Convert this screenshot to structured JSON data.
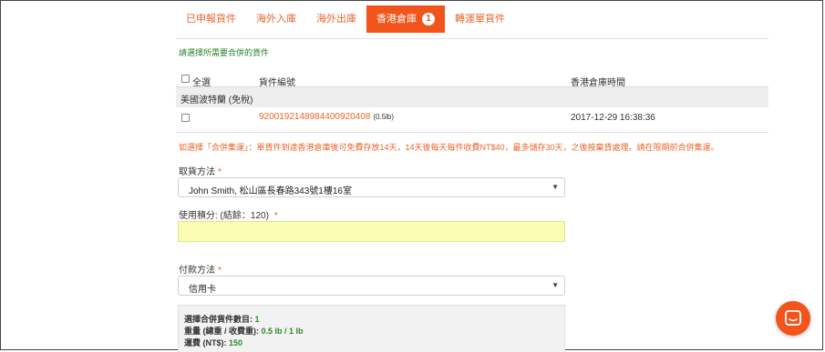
{
  "tabs": [
    {
      "label": "已申報貨件"
    },
    {
      "label": "海外入庫"
    },
    {
      "label": "海外出庫"
    },
    {
      "label": "香港倉庫",
      "badge": "1"
    },
    {
      "label": "轉運單貨件"
    }
  ],
  "instruction": "請選擇所需要合併的貨件",
  "table": {
    "select_all_label": "全選",
    "col_tracking": "貨件編號",
    "col_time": "香港倉庫時間",
    "group_label": "美國波特蘭 (免稅)",
    "rows": [
      {
        "tracking": "9200192148984400920408",
        "weight": "(0.5lb)",
        "time": "2017-12-29 16:38:36"
      }
    ]
  },
  "warning": "如選擇「合併集運」：單貨件到達香港倉庫後可免費存放14天，14天後每天每件收費NT$40，最多儲存30天，之後按棄貨處理。請在限期前合併集運。",
  "pickup": {
    "label": "取貨方法",
    "required_mark": "*",
    "value": "John Smith, 松山區長春路343號1樓16室"
  },
  "points": {
    "label": "使用積分: (結餘：120)",
    "required_mark": "*",
    "value": ""
  },
  "payment": {
    "label": "付款方法",
    "required_mark": "*",
    "value": "信用卡"
  },
  "summary": {
    "count_label": "選擇合併貨件數目: ",
    "count_value": "1",
    "weight_label": "重量 (總重 / 收費重): ",
    "weight_value": "0.5 lb / 1 lb",
    "fee_label": "運費 (NT$): ",
    "fee_value": "150"
  },
  "icons": {
    "chat": "chat-icon",
    "caret": "caret-down-icon"
  },
  "colors": {
    "accent": "#f2541b",
    "link": "#e8652c",
    "green": "#2a7f2a",
    "highlight": "#fbfdb5"
  }
}
